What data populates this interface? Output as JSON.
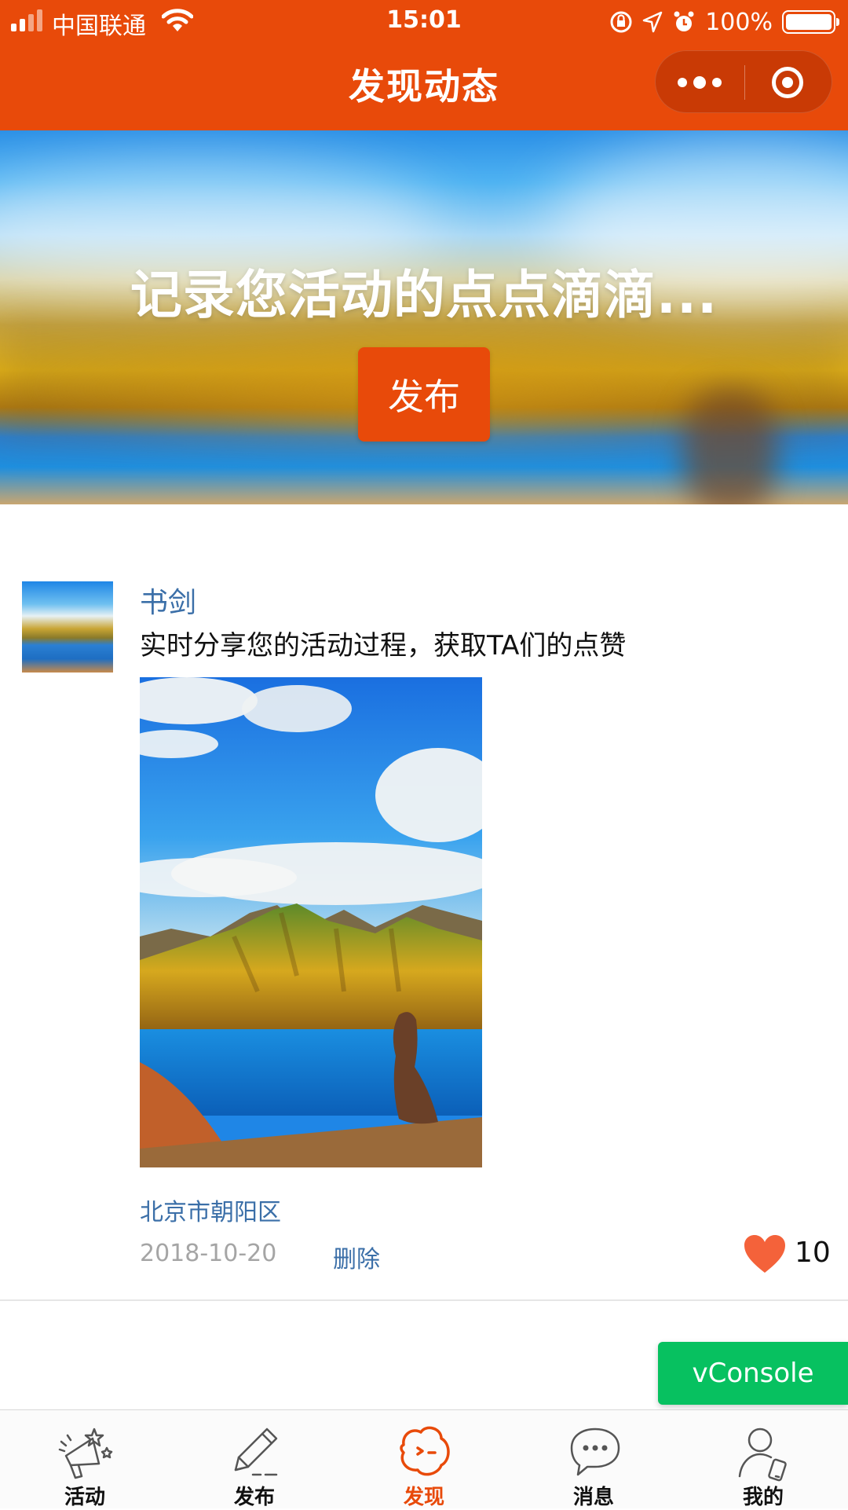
{
  "status_bar": {
    "carrier": "中国联通",
    "time": "15:01",
    "battery": "100%"
  },
  "nav": {
    "title": "发现动态"
  },
  "banner": {
    "slogan": "记录您活动的点点滴滴...",
    "publish_label": "发布"
  },
  "post": {
    "author": "书剑",
    "content": "实时分享您的活动过程，获取TA们的点赞",
    "location": "北京市朝阳区",
    "date": "2018-10-20",
    "delete_label": "删除",
    "like_count": "10"
  },
  "vconsole_label": "vConsole",
  "tabbar": {
    "items": [
      {
        "label": "活动",
        "icon": "megaphone-icon"
      },
      {
        "label": "发布",
        "icon": "pencil-icon"
      },
      {
        "label": "发现",
        "icon": "discover-face-icon",
        "active": true
      },
      {
        "label": "消息",
        "icon": "chat-bubble-icon"
      },
      {
        "label": "我的",
        "icon": "user-phone-icon"
      }
    ]
  },
  "colors": {
    "brand": "#e84a0a",
    "link": "#3b6fa8",
    "vconsole": "#07c160",
    "like": "#f4623a"
  }
}
